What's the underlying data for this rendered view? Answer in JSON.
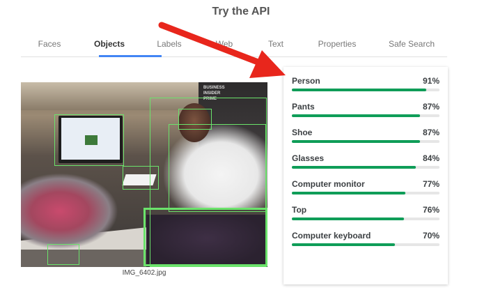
{
  "page": {
    "title": "Try the API"
  },
  "tabs": [
    {
      "label": "Faces",
      "active": false
    },
    {
      "label": "Objects",
      "active": true
    },
    {
      "label": "Labels",
      "active": false
    },
    {
      "label": "Web",
      "active": false
    },
    {
      "label": "Text",
      "active": false
    },
    {
      "label": "Properties",
      "active": false
    },
    {
      "label": "Safe Search",
      "active": false
    }
  ],
  "image": {
    "filename": "IMG_6402.jpg",
    "sign_text": [
      "BUSINESS",
      "INSIDER",
      "PRIME"
    ]
  },
  "results": [
    {
      "label": "Person",
      "score": "91%",
      "value": 0.91
    },
    {
      "label": "Pants",
      "score": "87%",
      "value": 0.87
    },
    {
      "label": "Shoe",
      "score": "87%",
      "value": 0.87
    },
    {
      "label": "Glasses",
      "score": "84%",
      "value": 0.84
    },
    {
      "label": "Computer monitor",
      "score": "77%",
      "value": 0.77
    },
    {
      "label": "Top",
      "score": "76%",
      "value": 0.76
    },
    {
      "label": "Computer keyboard",
      "score": "70%",
      "value": 0.7
    }
  ],
  "colors": {
    "accent_tab": "#4285f4",
    "bar_fill": "#0f9d58",
    "bbox": "#6be36b",
    "annotation_arrow": "#e8261c"
  },
  "icons": {
    "annotation": "red-arrow-icon"
  }
}
